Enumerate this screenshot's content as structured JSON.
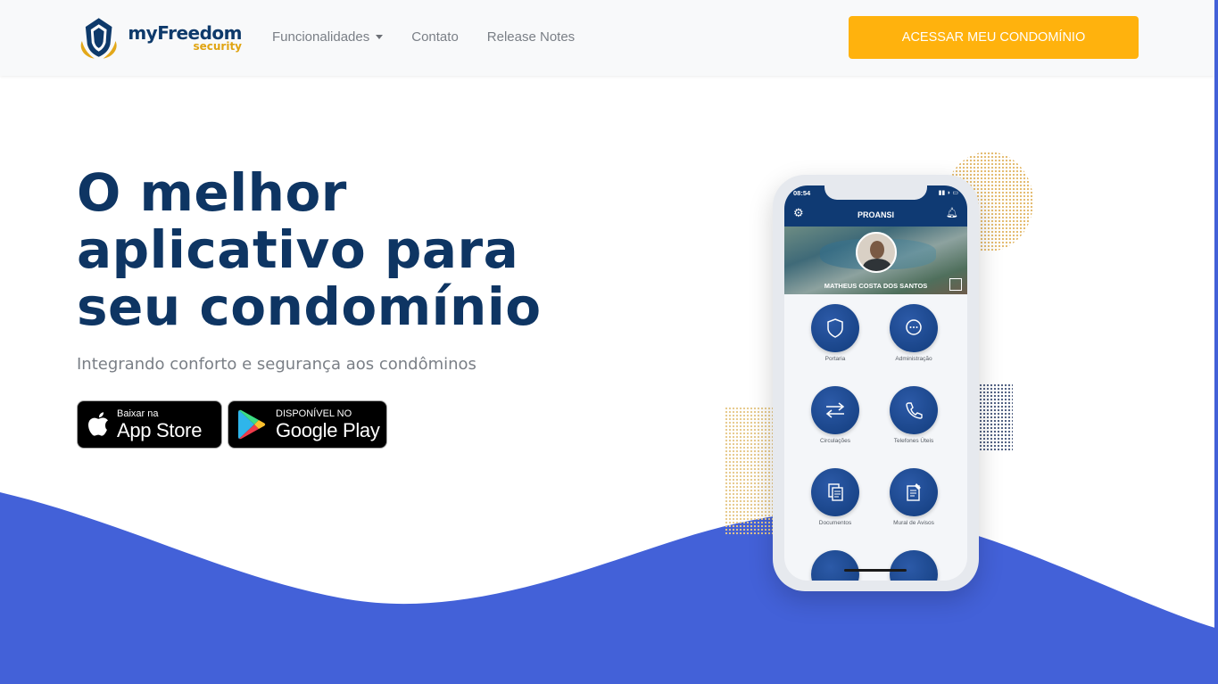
{
  "navbar": {
    "logo_main": "myFreedom",
    "logo_sub": "security",
    "links": [
      {
        "label": "Funcionalidades"
      },
      {
        "label": "Contato"
      },
      {
        "label": "Release Notes"
      }
    ],
    "cta_label": "ACESSAR MEU CONDOMÍNIO"
  },
  "hero": {
    "title_line1": "O melhor",
    "title_line2": "aplicativo para",
    "title_line3": "seu condomínio",
    "subtitle": "Integrando conforto e segurança aos condôminos"
  },
  "badges": {
    "apple_small": "Baixar na",
    "apple_big": "App Store",
    "google_small": "DISPONÍVEL NO",
    "google_big": "Google Play"
  },
  "phone": {
    "time": "08:54",
    "app_title": "PROANSI",
    "user_name": "MATHEUS COSTA DOS SANTOS",
    "menu": [
      {
        "label": "Portaria",
        "icon": "shield-icon"
      },
      {
        "label": "Administração",
        "icon": "chat-icon"
      },
      {
        "label": "Circulações",
        "icon": "swap-icon"
      },
      {
        "label": "Telefones Úteis",
        "icon": "phone-icon"
      },
      {
        "label": "Documentos",
        "icon": "documents-icon"
      },
      {
        "label": "Mural de Avisos",
        "icon": "notice-icon"
      }
    ]
  },
  "colors": {
    "brand_navy": "#0e3563",
    "cta_orange": "#ffb20d",
    "wave_blue": "#4361d8",
    "logo_gold": "#e0a412"
  }
}
